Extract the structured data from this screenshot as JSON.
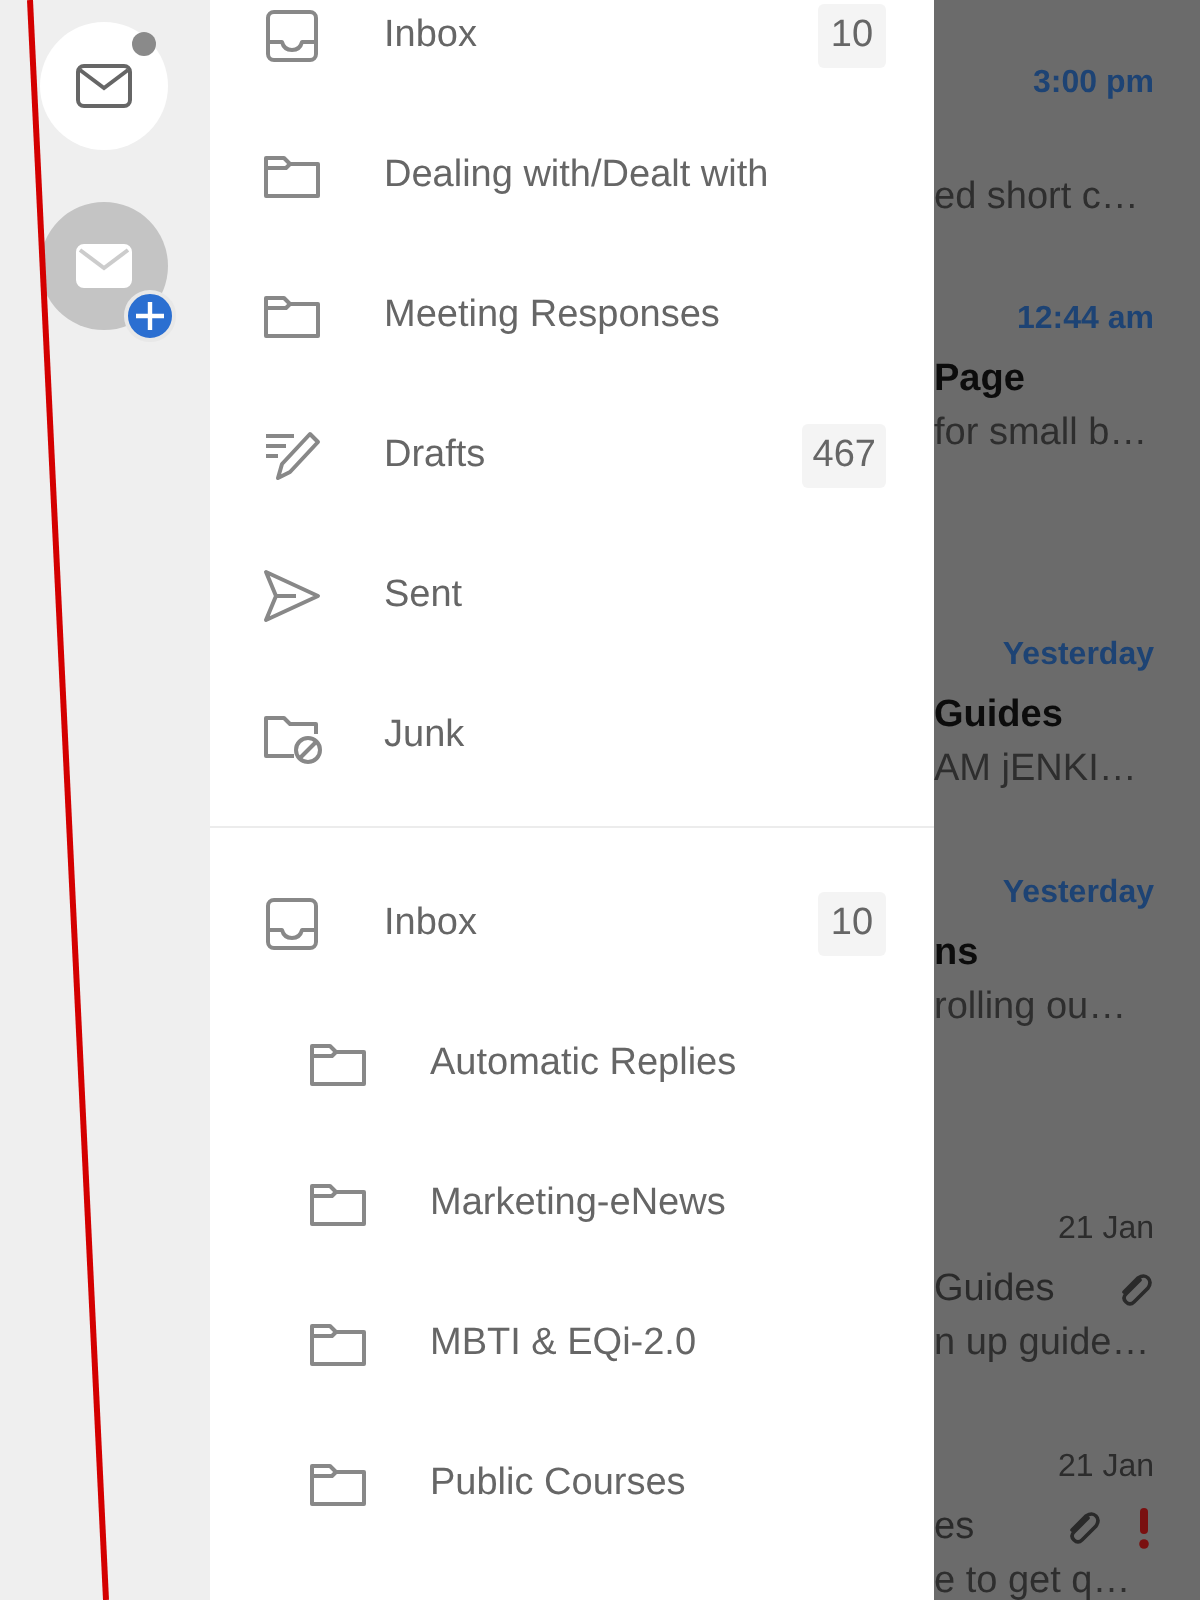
{
  "accounts": [
    {
      "kind": "mailbox",
      "selected": true,
      "notification": true
    },
    {
      "kind": "add",
      "selected": false,
      "notification": false
    }
  ],
  "folder_groups": [
    {
      "folders": [
        {
          "name": "Inbox",
          "kind": "inbox",
          "count": "10"
        },
        {
          "name": "Dealing with/Dealt with",
          "kind": "folder"
        },
        {
          "name": "Meeting Responses",
          "kind": "folder"
        },
        {
          "name": "Drafts",
          "kind": "drafts",
          "count": "467"
        },
        {
          "name": "Sent",
          "kind": "sent"
        },
        {
          "name": "Junk",
          "kind": "junk"
        }
      ]
    },
    {
      "folders": [
        {
          "name": "Inbox",
          "kind": "inbox",
          "count": "10",
          "children": [
            {
              "name": "Automatic Replies",
              "kind": "folder"
            },
            {
              "name": "Marketing-eNews",
              "kind": "folder"
            },
            {
              "name": "MBTI & EQi-2.0",
              "kind": "folder"
            },
            {
              "name": "Public Courses",
              "kind": "folder"
            }
          ]
        }
      ]
    }
  ],
  "messages": [
    {
      "time": "3:00 pm",
      "preview": "ed short c…",
      "unread": true,
      "attachment": false,
      "important": false
    },
    {
      "time": "12:44 am",
      "subject": "Page",
      "preview": "for small b…",
      "unread": true,
      "attachment": false,
      "important": false
    },
    {
      "time": "Yesterday",
      "subject": "Guides",
      "preview": "AM jENKI…",
      "unread": true,
      "attachment": false,
      "important": false
    },
    {
      "time": "Yesterday",
      "subject": "ns",
      "preview": "rolling ou…",
      "unread": true,
      "attachment": false,
      "important": false
    },
    {
      "time": "21 Jan",
      "subject": "Guides",
      "preview": "n up guide…",
      "unread": false,
      "attachment": true,
      "important": false
    },
    {
      "time": "21 Jan",
      "subject": "es",
      "preview": "e to get q…",
      "unread": false,
      "attachment": true,
      "important": true
    }
  ]
}
